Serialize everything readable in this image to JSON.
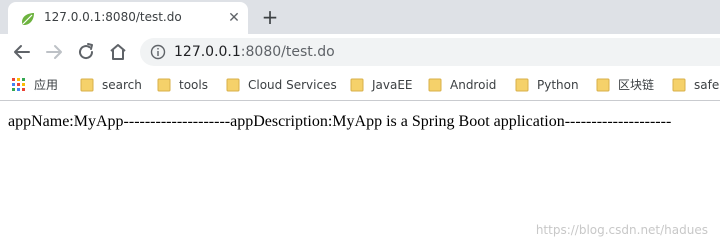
{
  "tab": {
    "title": "127.0.0.1:8080/test.do",
    "favicon": "spring-leaf-icon",
    "close_glyph": "✕"
  },
  "newtab_glyph": "+",
  "toolbar": {
    "url_host": "127.0.0.1",
    "url_rest": ":8080/test.do"
  },
  "bookmarks": {
    "apps_label": "应用",
    "items": [
      {
        "label": "search"
      },
      {
        "label": "tools"
      },
      {
        "label": "Cloud Services"
      },
      {
        "label": "JavaEE"
      },
      {
        "label": "Android"
      },
      {
        "label": "Python"
      },
      {
        "label": "区块链"
      },
      {
        "label": "safe"
      }
    ]
  },
  "page": {
    "text": "appName:MyApp--------------------appDescription:MyApp is a Spring Boot application--------------------"
  },
  "watermark": "https://blog.csdn.net/hadues",
  "colors": {
    "tabstrip": "#dee1e6",
    "omnibox": "#f1f3f4",
    "folder": "#f5d16a",
    "spring_green": "#6db33f"
  }
}
